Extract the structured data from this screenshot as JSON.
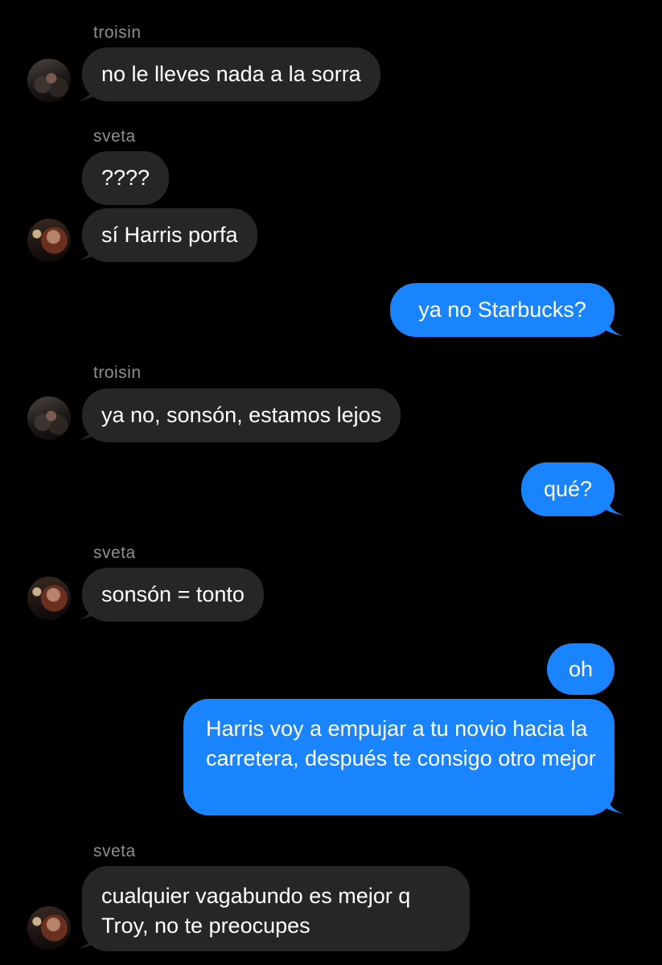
{
  "conversation": {
    "messages": [
      {
        "sender": "troisin",
        "text": "no le lleves nada a la sorra",
        "direction": "in"
      },
      {
        "sender": "sveta",
        "text": "????",
        "direction": "in"
      },
      {
        "sender": "sveta",
        "text": "sí Harris porfa",
        "direction": "in"
      },
      {
        "text": "ya no Starbucks?",
        "direction": "out"
      },
      {
        "sender": "troisin",
        "text": "ya no, sonsón, estamos lejos",
        "direction": "in"
      },
      {
        "text": "qué?",
        "direction": "out"
      },
      {
        "sender": "sveta",
        "text": "sonsón = tonto",
        "direction": "in"
      },
      {
        "text": "oh",
        "direction": "out"
      },
      {
        "text": "Harris voy a empujar a tu novio hacia la carretera, después te consigo otro mejor",
        "direction": "out"
      },
      {
        "sender": "sveta",
        "text": "cualquier vagabundo es mejor q Troy, no te preocupes",
        "direction": "in"
      }
    ],
    "sender_labels": [
      "troisin",
      "sveta",
      "troisin",
      "sveta",
      "sveta"
    ]
  },
  "colors": {
    "background": "#000000",
    "incoming_bubble": "#262628",
    "outgoing_bubble": "#1a84ff",
    "sender_name": "#8e8e93"
  },
  "icons": {
    "troisin_avatar": "avatar-troisin-icon",
    "sveta_avatar": "avatar-sveta-icon"
  }
}
